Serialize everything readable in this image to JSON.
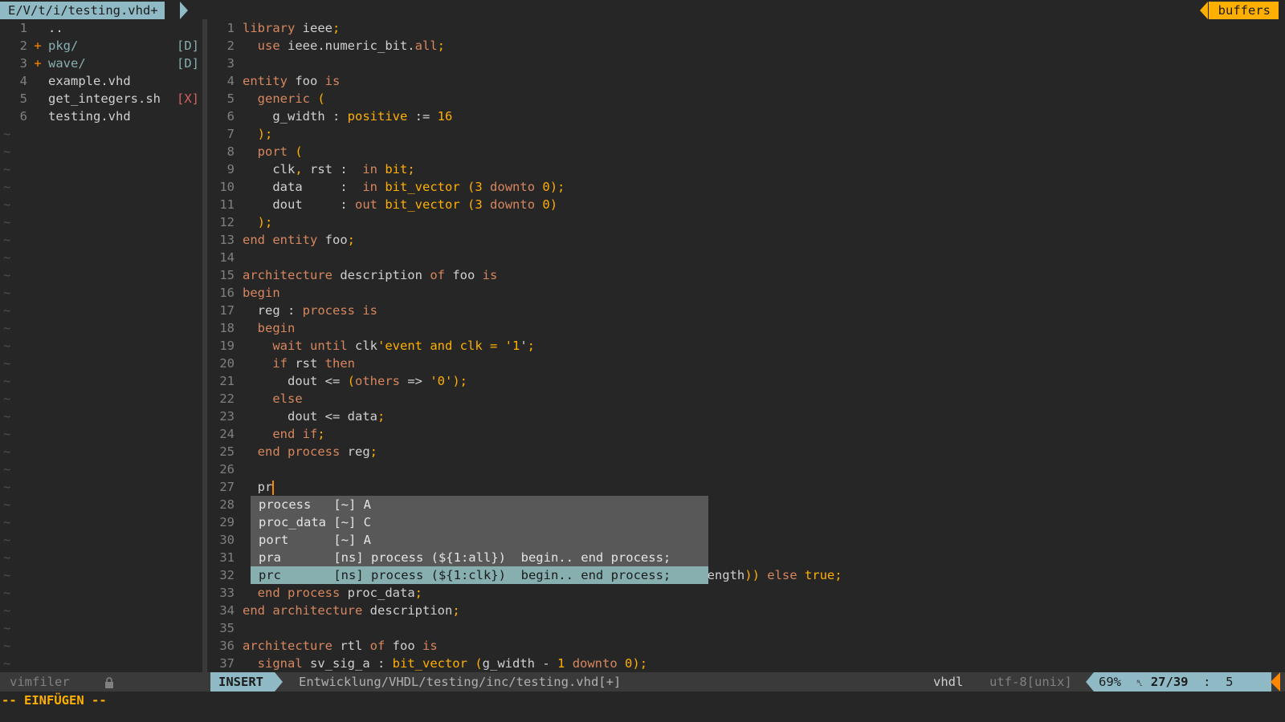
{
  "tabline": {
    "file": "E/V/t/i/testing.vhd+",
    "buffers_label": "buffers"
  },
  "filer": {
    "items": [
      {
        "num": "1",
        "mark": "",
        "name": "..",
        "tag": ""
      },
      {
        "num": "2",
        "mark": "+",
        "name": "pkg/",
        "tag": "[D]"
      },
      {
        "num": "3",
        "mark": "+",
        "name": "wave/",
        "tag": "[D]"
      },
      {
        "num": "4",
        "mark": "",
        "name": "example.vhd",
        "tag": ""
      },
      {
        "num": "5",
        "mark": "",
        "name": "get_integers.sh",
        "tag": "[X]"
      },
      {
        "num": "6",
        "mark": "",
        "name": "testing.vhd",
        "tag": ""
      }
    ],
    "tilde": "~"
  },
  "editor": {
    "lines": [
      {
        "n": "1",
        "text": "library ieee;"
      },
      {
        "n": "2",
        "text": "  use ieee.numeric_bit.all;"
      },
      {
        "n": "3",
        "text": ""
      },
      {
        "n": "4",
        "text": "entity foo is"
      },
      {
        "n": "5",
        "text": "  generic ("
      },
      {
        "n": "6",
        "text": "    g_width : positive := 16"
      },
      {
        "n": "7",
        "text": "  );"
      },
      {
        "n": "8",
        "text": "  port ("
      },
      {
        "n": "9",
        "text": "    clk, rst :  in bit;"
      },
      {
        "n": "10",
        "text": "    data     :  in bit_vector (3 downto 0);"
      },
      {
        "n": "11",
        "text": "    dout     : out bit_vector (3 downto 0)"
      },
      {
        "n": "12",
        "text": "  );"
      },
      {
        "n": "13",
        "text": "end entity foo;"
      },
      {
        "n": "14",
        "text": ""
      },
      {
        "n": "15",
        "text": "architecture description of foo is"
      },
      {
        "n": "16",
        "text": "begin"
      },
      {
        "n": "17",
        "text": "  reg : process is"
      },
      {
        "n": "18",
        "text": "  begin"
      },
      {
        "n": "19",
        "text": "    wait until clk'event and clk = '1';"
      },
      {
        "n": "20",
        "text": "    if rst then"
      },
      {
        "n": "21",
        "text": "      dout <= (others => '0');"
      },
      {
        "n": "22",
        "text": "    else"
      },
      {
        "n": "23",
        "text": "      dout <= data;"
      },
      {
        "n": "24",
        "text": "    end if;"
      },
      {
        "n": "25",
        "text": "  end process reg;"
      },
      {
        "n": "26",
        "text": ""
      },
      {
        "n": "27",
        "text": "  pr"
      },
      {
        "n": "28",
        "text": ""
      },
      {
        "n": "29",
        "text": ""
      },
      {
        "n": "30",
        "text": ""
      },
      {
        "n": "31",
        "text": ""
      },
      {
        "n": "32",
        "text": "                                                            'length)) else true;"
      },
      {
        "n": "33",
        "text": "  end process proc_data;"
      },
      {
        "n": "34",
        "text": "end architecture description;"
      },
      {
        "n": "35",
        "text": ""
      },
      {
        "n": "36",
        "text": "architecture rtl of foo is"
      },
      {
        "n": "37",
        "text": "  signal sv_sig_a : bit_vector (g_width - 1 downto 0);"
      }
    ]
  },
  "completion": {
    "items": [
      {
        "text": "process   [~] A"
      },
      {
        "text": "proc_data [~] C"
      },
      {
        "text": "port      [~] A"
      },
      {
        "text": "pra       [ns] process (${1:all})  begin.. end process;"
      },
      {
        "text": "prc       [ns] process (${1:clk})  begin.. end process;"
      }
    ],
    "selected_index": 4
  },
  "statusbar": {
    "filer_name": "vimfiler",
    "lock_icon": "lock-icon",
    "mode": "INSERT",
    "path": "Entwicklung/VHDL/testing/inc/testing.vhd[+]",
    "filetype": "vhdl",
    "encoding": "utf-8[unix]",
    "percent": "69%",
    "line_col": "27/39",
    "col": "5"
  },
  "cmdline": "-- EINFÜGEN --",
  "colors": {
    "accent": "#8fb9c4",
    "orange": "#ffaf00",
    "keyword": "#d7875f",
    "bg": "#262626"
  }
}
